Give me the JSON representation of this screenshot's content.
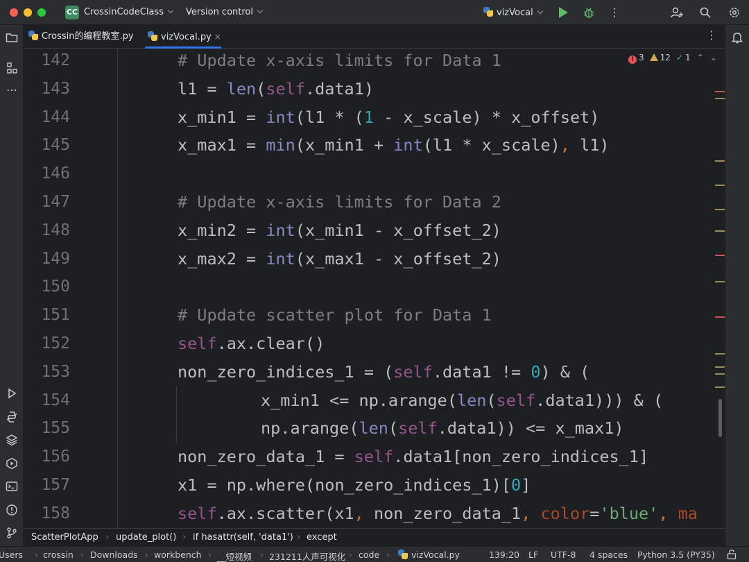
{
  "titlebar": {
    "project_badge": "CC",
    "project_name": "CrossinCodeClass",
    "version_control": "Version control",
    "run_config": "vizVocal"
  },
  "tabs": [
    {
      "label": "Crossin的编程教室.py",
      "active": false
    },
    {
      "label": "vizVocal.py",
      "active": true,
      "close": "×"
    }
  ],
  "inspections": {
    "errors": "3",
    "warnings": "12",
    "weak_warnings": "1",
    "error_icon_glyph": "!"
  },
  "editor": {
    "lines": [
      {
        "num": "142",
        "indent": 1,
        "tokens": [
          {
            "t": "# Update x-axis limits for Data 1",
            "c": "comment"
          }
        ]
      },
      {
        "num": "143",
        "indent": 1,
        "tokens": [
          {
            "t": "l1 = "
          },
          {
            "t": "len",
            "c": "builtin"
          },
          {
            "t": "("
          },
          {
            "t": "self",
            "c": "self"
          },
          {
            "t": ".data1)"
          }
        ]
      },
      {
        "num": "144",
        "indent": 1,
        "tokens": [
          {
            "t": "x_min1 = "
          },
          {
            "t": "int",
            "c": "builtin"
          },
          {
            "t": "(l1 * ("
          },
          {
            "t": "1",
            "c": "num"
          },
          {
            "t": " - x_scale) * x_offset)"
          }
        ]
      },
      {
        "num": "145",
        "indent": 1,
        "tokens": [
          {
            "t": "x_max1 = "
          },
          {
            "t": "min",
            "c": "builtin"
          },
          {
            "t": "(x_min1 + "
          },
          {
            "t": "int",
            "c": "builtin"
          },
          {
            "t": "(l1 * x_scale)"
          },
          {
            "t": ",",
            "c": "comma"
          },
          {
            "t": " l1)"
          }
        ]
      },
      {
        "num": "146",
        "indent": 1,
        "tokens": []
      },
      {
        "num": "147",
        "indent": 1,
        "tokens": [
          {
            "t": "# Update x-axis limits for Data 2",
            "c": "comment"
          }
        ]
      },
      {
        "num": "148",
        "indent": 1,
        "tokens": [
          {
            "t": "x_min2 = "
          },
          {
            "t": "int",
            "c": "builtin"
          },
          {
            "t": "(x_min1 - x_offset_2)"
          }
        ]
      },
      {
        "num": "149",
        "indent": 1,
        "tokens": [
          {
            "t": "x_max2 = "
          },
          {
            "t": "int",
            "c": "builtin"
          },
          {
            "t": "(x_max1 - x_offset_2)"
          }
        ]
      },
      {
        "num": "150",
        "indent": 1,
        "tokens": []
      },
      {
        "num": "151",
        "indent": 1,
        "tokens": [
          {
            "t": "# Update scatter plot for Data 1",
            "c": "comment"
          }
        ]
      },
      {
        "num": "152",
        "indent": 1,
        "tokens": [
          {
            "t": "self",
            "c": "self"
          },
          {
            "t": ".ax.clear()"
          }
        ]
      },
      {
        "num": "153",
        "indent": 1,
        "tokens": [
          {
            "t": "non_zero_indices_1 = ("
          },
          {
            "t": "self",
            "c": "self"
          },
          {
            "t": ".data1 != "
          },
          {
            "t": "0",
            "c": "num"
          },
          {
            "t": ") & ("
          }
        ]
      },
      {
        "num": "154",
        "indent": 2,
        "tokens": [
          {
            "t": "x_min1 <= np.arange("
          },
          {
            "t": "len",
            "c": "builtin"
          },
          {
            "t": "("
          },
          {
            "t": "self",
            "c": "self"
          },
          {
            "t": ".data1))) & ("
          }
        ]
      },
      {
        "num": "155",
        "indent": 2,
        "tokens": [
          {
            "t": "np.arange("
          },
          {
            "t": "len",
            "c": "builtin"
          },
          {
            "t": "("
          },
          {
            "t": "self",
            "c": "self"
          },
          {
            "t": ".data1)) <= x_max1)"
          }
        ]
      },
      {
        "num": "156",
        "indent": 1,
        "tokens": [
          {
            "t": "non_zero_data_1 = "
          },
          {
            "t": "self",
            "c": "self"
          },
          {
            "t": ".data1[non_zero_indices_1]"
          }
        ]
      },
      {
        "num": "157",
        "indent": 1,
        "tokens": [
          {
            "t": "x1 = np.where(non_zero_indices_1)["
          },
          {
            "t": "0",
            "c": "num"
          },
          {
            "t": "]"
          }
        ]
      },
      {
        "num": "158",
        "indent": 1,
        "tokens": [
          {
            "t": "self",
            "c": "self"
          },
          {
            "t": ".ax.scatter(x1"
          },
          {
            "t": ",",
            "c": "comma"
          },
          {
            "t": " non_zero_data_1"
          },
          {
            "t": ",",
            "c": "comma"
          },
          {
            "t": " "
          },
          {
            "t": "color",
            "c": "param"
          },
          {
            "t": "="
          },
          {
            "t": "'blue'",
            "c": "str"
          },
          {
            "t": ",",
            "c": "comma"
          },
          {
            "t": " "
          },
          {
            "t": "ma",
            "c": "param"
          }
        ]
      }
    ]
  },
  "breadcrumbs": [
    "ScatterPlotApp",
    "update_plot()",
    "if hasattr(self, 'data1')",
    "except"
  ],
  "statusbar": {
    "path": [
      "Users",
      "crossin",
      "Downloads",
      "workbench",
      "__短视频",
      "231211人声可视化",
      "code",
      "vizVocal.py"
    ],
    "position": "139:20",
    "line_sep": "LF",
    "encoding": "UTF-8",
    "indent": "4 spaces",
    "interpreter": "Python 3.5 (PY35)"
  },
  "colors": {
    "background": "#1e1f22",
    "chrome": "#2b2d30",
    "accent": "#3574f0",
    "comment": "#7a7e85",
    "builtin": "#8888c6",
    "self": "#94558d",
    "number": "#2aacb8",
    "string": "#6aab73",
    "keyword_arg": "#aa4926",
    "error": "#e55353",
    "warning": "#d1a84f"
  }
}
